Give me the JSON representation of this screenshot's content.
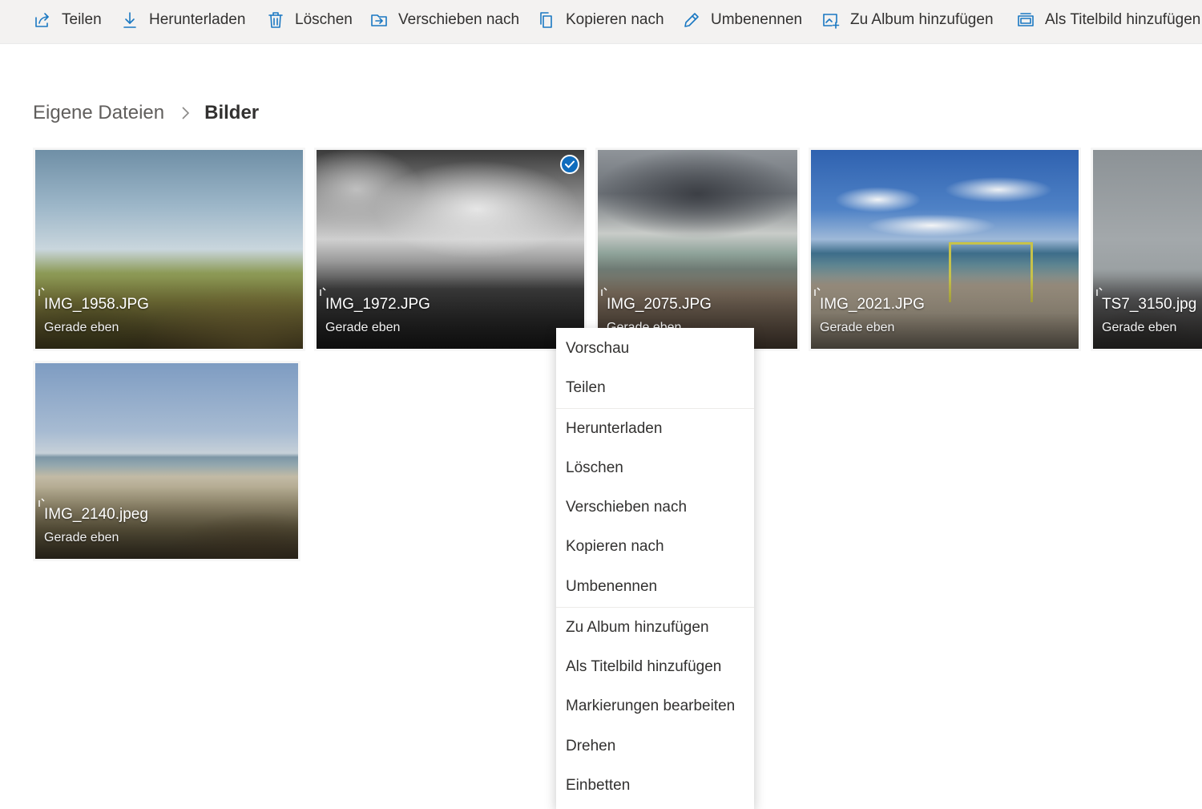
{
  "toolbar": {
    "share": "Teilen",
    "download": "Herunterladen",
    "delete": "Löschen",
    "move_to": "Verschieben nach",
    "copy_to": "Kopieren nach",
    "rename": "Umbenennen",
    "add_to_album": "Zu Album hinzufügen",
    "set_cover": "Als Titelbild hinzufügen"
  },
  "breadcrumb": {
    "parent": "Eigene Dateien",
    "current": "Bilder"
  },
  "files": [
    {
      "name": "IMG_1958.JPG",
      "date": "Gerade eben",
      "selected": false
    },
    {
      "name": "IMG_1972.JPG",
      "date": "Gerade eben",
      "selected": true
    },
    {
      "name": "IMG_2075.JPG",
      "date": "Gerade eben",
      "selected": false
    },
    {
      "name": "IMG_2021.JPG",
      "date": "Gerade eben",
      "selected": false
    },
    {
      "name": "TS7_3150.jpg",
      "date": "Gerade eben",
      "selected": false
    },
    {
      "name": "IMG_2140.jpeg",
      "date": "Gerade eben",
      "selected": false
    }
  ],
  "context_menu": {
    "items": [
      "Vorschau",
      "Teilen",
      "Herunterladen",
      "Löschen",
      "Verschieben nach",
      "Kopieren nach",
      "Umbenennen",
      "Zu Album hinzufügen",
      "Als Titelbild hinzufügen",
      "Markierungen bearbeiten",
      "Drehen",
      "Einbetten"
    ]
  },
  "colors": {
    "accent": "#1a78c2",
    "selection": "#0f6cbd",
    "toolbar_bg": "#f3f2f1"
  }
}
